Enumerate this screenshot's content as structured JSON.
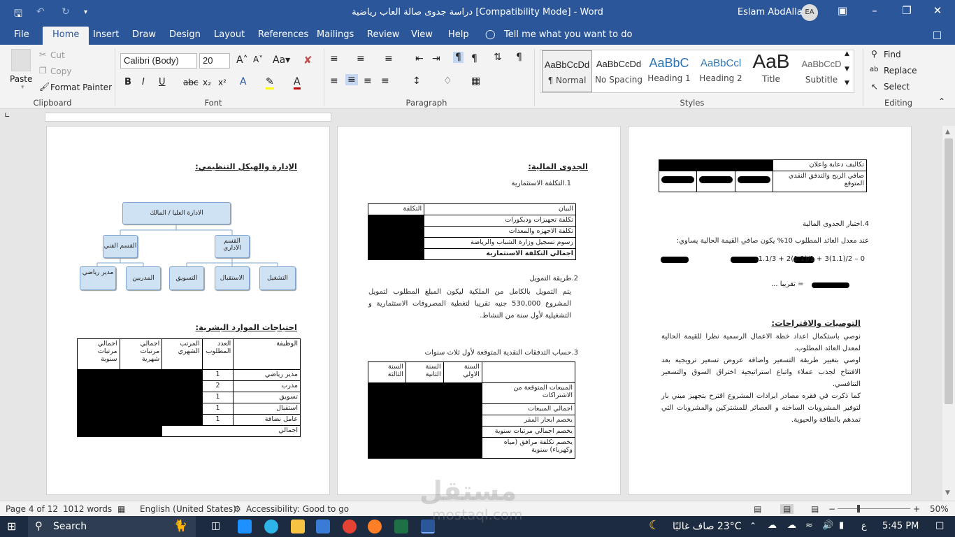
{
  "window": {
    "title": "دراسة جدوى صالة العاب رياضية [Compatibility Mode]  -  Word",
    "user": "Eslam AbdAllah",
    "avatar": "EA"
  },
  "tabs": [
    "File",
    "Home",
    "Insert",
    "Draw",
    "Design",
    "Layout",
    "References",
    "Mailings",
    "Review",
    "View",
    "Help"
  ],
  "tell_me": "Tell me what you want to do",
  "clipboard": {
    "paste": "Paste",
    "cut": "Cut",
    "copy": "Copy",
    "format_painter": "Format Painter",
    "label": "Clipboard"
  },
  "font": {
    "name": "Calibri (Body)",
    "size": "20",
    "label": "Font"
  },
  "paragraph": {
    "label": "Paragraph"
  },
  "styles": {
    "label": "Styles",
    "items": [
      {
        "preview": "AaBbCcDd",
        "name": "¶ Normal"
      },
      {
        "preview": "AaBbCcDd",
        "name": "No Spacing"
      },
      {
        "preview": "AaBbC",
        "name": "Heading 1"
      },
      {
        "preview": "AaBbCcl",
        "name": "Heading 2"
      },
      {
        "preview": "AaB",
        "name": "Title"
      },
      {
        "preview": "AaBbCcD",
        "name": "Subtitle"
      }
    ]
  },
  "editing": {
    "find": "Find",
    "replace": "Replace",
    "select": "Select",
    "label": "Editing"
  },
  "page1": {
    "heading_org": "الإدارة والهيكل التنظيمي:",
    "org": {
      "top": "الادارة العليا / المالك",
      "tech": "القسم الفني",
      "admin": "القسم الاداري",
      "coach": "مدير رياضي",
      "trainers": "المدربين",
      "marketing": "التسويق",
      "reception": "الاستقبال",
      "operation": "التشغيل"
    },
    "heading_hr": "احتياجات الموارد البشرية:",
    "hr_headers": [
      "الوظيفة",
      "العدد المطلوب",
      "المرتب الشهري",
      "اجمالي مرتبات شهرية",
      "اجمالي مرتبات سنوية"
    ],
    "hr_rows": [
      {
        "job": "مدير رياضي",
        "count": "1"
      },
      {
        "job": "مدرب",
        "count": "2"
      },
      {
        "job": "تسويق",
        "count": "1"
      },
      {
        "job": "استقبال",
        "count": "1"
      },
      {
        "job": "عامل نضافة",
        "count": "1"
      }
    ],
    "hr_total": "اجمالي"
  },
  "page2": {
    "heading": "الجدوى المالية:",
    "s1": "1.التكلفة الاستثمارية",
    "inv_headers": [
      "البيان",
      "التكلفة"
    ],
    "inv_rows": [
      "تكلفة تجهيزات وديكورات",
      "تكلفة الاجهزه والمعدات",
      "رسوم تسجيل وزارة الشباب والرياضة",
      "اجمالي التكلفة الاستثمارية"
    ],
    "s2": "2.طريقة التمويل",
    "funding": "يتم التمويل بالكامل من الملكية ليكون المبلغ المطلوب لتمويل المشروع 530,000 جنيه تقريبا لتغطية المصروفات الاستثمارية و التشغيلية لأول سنة من النشاط.",
    "s3": "3.حساب التدفقات النقدية المتوقعة لأول ثلاث سنوات",
    "cf_headers": [
      "السنة الاولي",
      "السنة الثانية",
      "السنة الثالثة"
    ],
    "cf_rows": [
      "المبيعات المتوقعة من الاشتراكات",
      "اجمالي المبيعات",
      "يخصم ايجار المقر",
      "يخصم اجمالي مرتبات سنوية",
      "يخصم تكلفة مرافق (مياه وكهرباء) سنوية"
    ]
  },
  "page3": {
    "t_rows": [
      "تكاليف دعاية واعلان",
      "صافي الربح والتدفق النقدي المتوقع"
    ],
    "s4": "4.اختبار الجدوى المالية",
    "npv_text": "عند معدل العائد المطلوب 10% يكون صافي القيمة الحالية يساوي:",
    "formula": "1.1/3 + 2(1.1)/1 + 3(1.1)/2 – 0",
    "approx": "= تقريبا ...",
    "heading_rec": "التوصيات والاقتراحات:",
    "rec1": "نوصي باستكمال اعداد خطة الاعمال الرسمية نظرا للقيمة الحالية لمعدل العائد المطلوب.",
    "rec2": "اوصي بتغيير طريقة التسعير واضافة عروض تسعير ترويجية بعد الافتتاح لجذب عملاء واتباع استراتيجية اختراق السوق والتسعير التنافسي.",
    "rec3": "كما ذكرت في فقره مصادر ايرادات المشروع اقترح بتجهيز ميني بار لتوفير المشروبات الساخنه و العصائر للمشتركين والمشروبات التي تمدهم بالطاقة والحيوية."
  },
  "status": {
    "page": "Page 4 of 12",
    "words": "1012 words",
    "lang": "English (United States)",
    "accessibility": "Accessibility: Good to go",
    "zoom": "50%"
  },
  "taskbar": {
    "search": "Search",
    "weather": "23°C  صاف غالبًا",
    "time": "5:45 PM",
    "lang": "ع"
  },
  "watermark": {
    "ar": "مستقل",
    "en": "mostaql.com"
  }
}
